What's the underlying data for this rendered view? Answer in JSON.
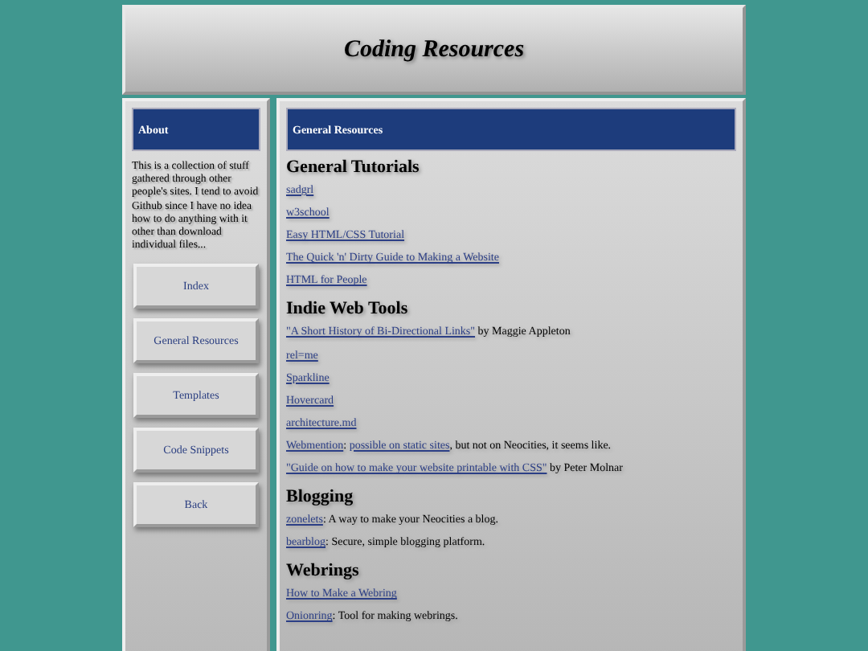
{
  "header": {
    "title": "Coding Resources"
  },
  "sidebar": {
    "heading": "About",
    "text": "This is a collection of stuff gathered through other people's sites. I tend to avoid Github since I have no idea how to do anything with it other than download individual files...",
    "nav": [
      "Index",
      "General Resources",
      "Templates",
      "Code Snippets",
      "Back"
    ]
  },
  "main": {
    "heading": "General Resources",
    "sections": [
      {
        "title": "General Tutorials",
        "entries": [
          [
            {
              "text": "sadgrl",
              "link": true
            }
          ],
          [
            {
              "text": "w3school",
              "link": true
            }
          ],
          [
            {
              "text": "Easy HTML/CSS Tutorial",
              "link": true
            }
          ],
          [
            {
              "text": "The Quick 'n' Dirty Guide to Making a Website",
              "link": true
            }
          ],
          [
            {
              "text": "HTML for People",
              "link": true
            }
          ]
        ]
      },
      {
        "title": "Indie Web Tools",
        "entries": [
          [
            {
              "text": "\"A Short History of Bi-Directional Links\"",
              "link": true
            },
            {
              "text": " by Maggie Appleton",
              "link": false
            }
          ],
          [
            {
              "text": "rel=me",
              "link": true
            }
          ],
          [
            {
              "text": "Sparkline",
              "link": true
            }
          ],
          [
            {
              "text": "Hovercard",
              "link": true
            }
          ],
          [
            {
              "text": "architecture.md",
              "link": true
            }
          ],
          [
            {
              "text": "Webmention",
              "link": true
            },
            {
              "text": ": ",
              "link": false
            },
            {
              "text": "possible on static sites",
              "link": true
            },
            {
              "text": ", but not on Neocities, it seems like.",
              "link": false
            }
          ],
          [
            {
              "text": "\"Guide on how to make your website printable with CSS\"",
              "link": true
            },
            {
              "text": " by Peter Molnar",
              "link": false
            }
          ]
        ]
      },
      {
        "title": "Blogging",
        "entries": [
          [
            {
              "text": "zonelets",
              "link": true
            },
            {
              "text": ": A way to make your Neocities a blog.",
              "link": false
            }
          ],
          [
            {
              "text": "bearblog",
              "link": true
            },
            {
              "text": ": Secure, simple blogging platform.",
              "link": false
            }
          ]
        ]
      },
      {
        "title": "Webrings",
        "entries": [
          [
            {
              "text": "How to Make a Webring",
              "link": true
            }
          ],
          [
            {
              "text": "Onionring",
              "link": true
            },
            {
              "text": ": Tool for making webrings.",
              "link": false
            }
          ]
        ]
      }
    ]
  }
}
